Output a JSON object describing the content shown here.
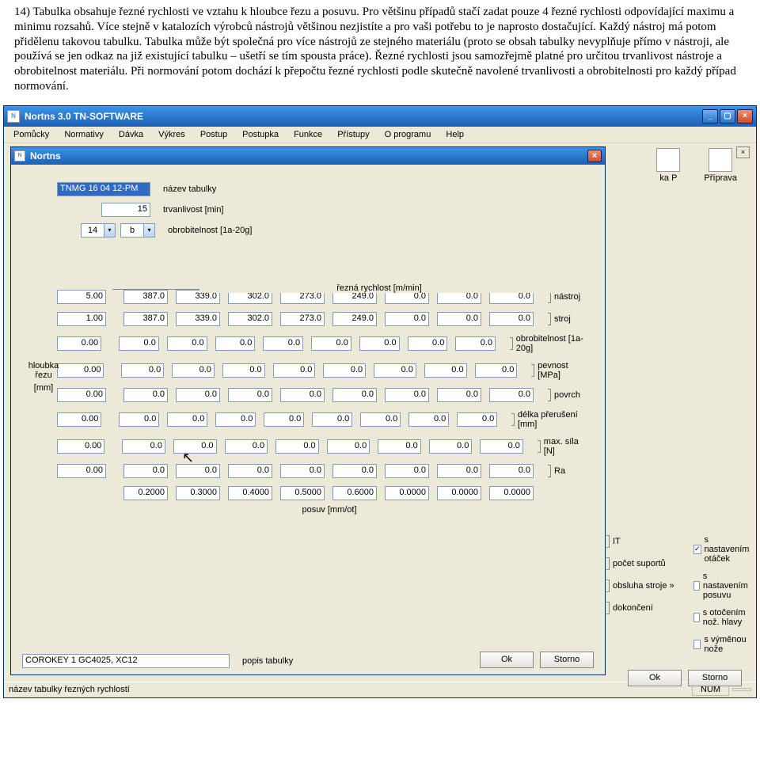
{
  "doc": {
    "paragraph": "14) Tabulka obsahuje řezné rychlosti ve vztahu k hloubce řezu a posuvu. Pro většinu případů stačí zadat pouze 4 řezné rychlosti odpovídající maximu a minimu rozsahů. Více stejně v katalozích výrobců nástrojů většinou nezjistíte a pro vaši potřebu to je naprosto dostačující. Každý nástroj má potom přidělenu takovou tabulku. Tabulka může být společná pro více nástrojů ze stejného materiálu (proto se obsah tabulky nevyplňuje přímo v nástroji, ale používá se jen odkaz na již existující tabulku – ušetří se tím spousta práce). Řezné rychlosti jsou samozřejmě platné pro určitou trvanlivost nástroje a obrobitelnost materiálu. Při normování potom dochází k přepočtu řezné rychlosti podle skutečně navolené trvanlivosti a obrobitelnosti pro každý případ normování."
  },
  "app": {
    "title": "Nortns 3.0 TN-SOFTWARE",
    "menu": [
      "Pomůcky",
      "Normativy",
      "Dávka",
      "Výkres",
      "Postup",
      "Postupka",
      "Funkce",
      "Přístupy",
      "O programu",
      "Help"
    ],
    "status_left": "název tabulky řezných rychlostí",
    "status_num": "NUM",
    "bg_icons": {
      "kaP": "ka P",
      "priprava": "Příprava"
    },
    "outer_ok": "Ok",
    "outer_storno": "Storno"
  },
  "dlg": {
    "title": "Nortns",
    "name_val": "TNMG 16 04 12-PM",
    "name_lab": "název tabulky",
    "trv_val": "15",
    "trv_lab": "trvanlivost [min]",
    "obr_a": "14",
    "obr_b": "b",
    "obr_lab": "obrobitelnost [1a-20g]",
    "left_tag1": "hloubka řezu",
    "left_tag2": "[mm]",
    "sec_title": "řezná rychlost [m/min]",
    "posuv_lab": "posuv [mm/ot]",
    "popis_val": "COROKEY 1   GC4025, XC12",
    "popis_lab": "popis tabulky",
    "ok": "Ok",
    "storno": "Storno"
  },
  "grid": {
    "lead": [
      "5.00",
      "1.00",
      "0.00",
      "0.00",
      "0.00",
      "0.00",
      "0.00",
      "0.00"
    ],
    "rows": [
      [
        "387.0",
        "339.0",
        "302.0",
        "273.0",
        "249.0",
        "0.0",
        "0.0",
        "0.0"
      ],
      [
        "387.0",
        "339.0",
        "302.0",
        "273.0",
        "249.0",
        "0.0",
        "0.0",
        "0.0"
      ],
      [
        "0.0",
        "0.0",
        "0.0",
        "0.0",
        "0.0",
        "0.0",
        "0.0",
        "0.0"
      ],
      [
        "0.0",
        "0.0",
        "0.0",
        "0.0",
        "0.0",
        "0.0",
        "0.0",
        "0.0"
      ],
      [
        "0.0",
        "0.0",
        "0.0",
        "0.0",
        "0.0",
        "0.0",
        "0.0",
        "0.0"
      ],
      [
        "0.0",
        "0.0",
        "0.0",
        "0.0",
        "0.0",
        "0.0",
        "0.0",
        "0.0"
      ],
      [
        "0.0",
        "0.0",
        "0.0",
        "0.0",
        "0.0",
        "0.0",
        "0.0",
        "0.0"
      ],
      [
        "0.0",
        "0.0",
        "0.0",
        "0.0",
        "0.0",
        "0.0",
        "0.0",
        "0.0"
      ]
    ],
    "side": [
      "nástroj",
      "stroj",
      "obrobitelnost [1a-20g]",
      "pevnost [MPa]",
      "povrch",
      "délka přerušení [mm]",
      "max. síla [N]",
      "Ra",
      "IT",
      "počet suportů",
      "obsluha stroje »",
      "dokončení"
    ],
    "posuv": [
      "0.2000",
      "0.3000",
      "0.4000",
      "0.5000",
      "0.6000",
      "0.0000",
      "0.0000",
      "0.0000"
    ],
    "chks": [
      "s nastavením otáček",
      "s nastavením posuvu",
      "s otočením nož. hlavy",
      "s výměnou nože"
    ],
    "chk_on": [
      true,
      false,
      false,
      false
    ]
  }
}
